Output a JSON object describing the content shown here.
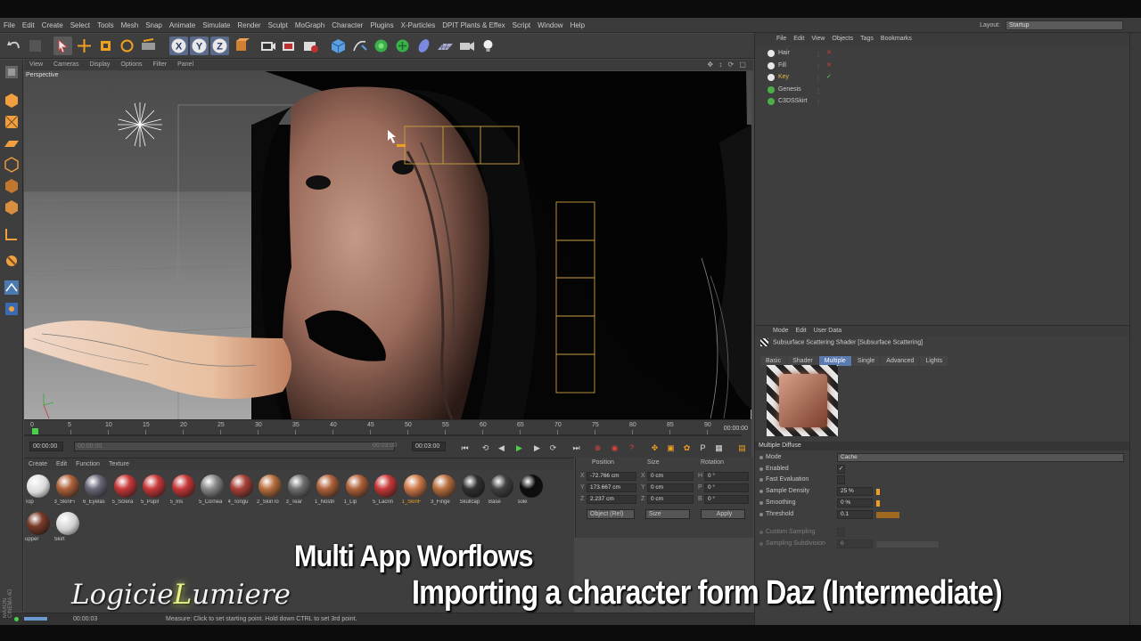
{
  "menu": [
    "File",
    "Edit",
    "Create",
    "Select",
    "Tools",
    "Mesh",
    "Snap",
    "Animate",
    "Simulate",
    "Render",
    "Sculpt",
    "MoGraph",
    "Character",
    "Plugins",
    "X-Particles",
    "DPIT Plants & Effex",
    "Script",
    "Window",
    "Help"
  ],
  "layout": {
    "label": "Layout:",
    "value": "Startup"
  },
  "viewport_menu": [
    "View",
    "Cameras",
    "Display",
    "Options",
    "Filter",
    "Panel"
  ],
  "viewport_label": "Perspective",
  "timeline": {
    "ticks": [
      "0",
      "5",
      "10",
      "15",
      "20",
      "25",
      "30",
      "35",
      "40",
      "45",
      "50",
      "55",
      "60",
      "65",
      "70",
      "75",
      "80",
      "85",
      "90"
    ],
    "end_frame": "00:00:00",
    "start_field": "00:00:00",
    "start_field2": "00:00:00",
    "end_field": "00:03:00",
    "end_field2": "00:03:00"
  },
  "material_menu": [
    "Create",
    "Edit",
    "Function",
    "Texture"
  ],
  "materials": [
    {
      "label": "Top",
      "color": "#d8d8d8"
    },
    {
      "label": "3_SkinFi",
      "color": "#b0623a"
    },
    {
      "label": "6_Eyelas",
      "color": "#6a6a7a"
    },
    {
      "label": "5_Sclera",
      "color": "#c93838"
    },
    {
      "label": "5_Pupil",
      "color": "#c93838"
    },
    {
      "label": "5_Iris",
      "color": "#c93838"
    },
    {
      "label": "5_Cornea",
      "color": "#8a8a8a"
    },
    {
      "label": "4_Tongu",
      "color": "#a84038"
    },
    {
      "label": "2_SkinTo",
      "color": "#b9703f"
    },
    {
      "label": "3_Tear",
      "color": "#707070"
    },
    {
      "label": "1_Nostri",
      "color": "#b0623a"
    },
    {
      "label": "1_Lip",
      "color": "#b0623a"
    },
    {
      "label": "5_Lacrin",
      "color": "#c93838"
    },
    {
      "label": "1_SkinF",
      "color": "#d07a4a"
    },
    {
      "label": "3_Finge",
      "color": "#b9703f"
    },
    {
      "label": "Skullcap",
      "color": "#303030"
    },
    {
      "label": "Base",
      "color": "#404040"
    },
    {
      "label": "sole",
      "color": "#0c0c0c"
    },
    {
      "label": "upper",
      "color": "#7a3a28"
    },
    {
      "label": "Skirt",
      "color": "#cfcfcf"
    }
  ],
  "coords": {
    "headers": [
      "Position",
      "Size",
      "Rotation"
    ],
    "rows": [
      {
        "a": "X",
        "p": "-72.766 cm",
        "b": "X",
        "s": "0 cm",
        "c": "H",
        "r": "0 °"
      },
      {
        "a": "Y",
        "p": "173.667 cm",
        "b": "Y",
        "s": "0 cm",
        "c": "P",
        "r": "0 °"
      },
      {
        "a": "Z",
        "p": "2.237 cm",
        "b": "Z",
        "s": "0 cm",
        "c": "B",
        "r": "0 °"
      }
    ],
    "mode": "Object (Rel)",
    "size_mode": "Size",
    "apply": "Apply"
  },
  "object_menu": [
    "File",
    "Edit",
    "View",
    "Objects",
    "Tags",
    "Bookmarks"
  ],
  "objects": [
    {
      "name": "Hair",
      "color": "#c9c9c9",
      "flag": "✕",
      "flag_color": "#d83a3a"
    },
    {
      "name": "Fill",
      "color": "#c9c9c9",
      "flag": "✕",
      "flag_color": "#d83a3a"
    },
    {
      "name": "Key",
      "color": "#e8b84a",
      "flag": "✓",
      "flag_color": "#6ad06a"
    },
    {
      "name": "Genesis",
      "color": "#c9c9c9",
      "flag": "",
      "flag_color": "#888"
    },
    {
      "name": "C3DSSkirt",
      "color": "#c9c9c9",
      "flag": "",
      "flag_color": "#888"
    }
  ],
  "attr_menu": [
    "Mode",
    "Edit",
    "User Data"
  ],
  "attr_title": "Subsurface Scattering Shader [Subsurface Scattering]",
  "attr_tabs": [
    {
      "label": "Basic",
      "on": false
    },
    {
      "label": "Shader",
      "on": false
    },
    {
      "label": "Multiple",
      "on": true
    },
    {
      "label": "Single",
      "on": false
    },
    {
      "label": "Advanced",
      "on": false
    },
    {
      "label": "Lights",
      "on": false
    }
  ],
  "section": "Multiple Diffuse",
  "params": [
    {
      "label": "Mode",
      "value": "Cache"
    },
    {
      "label": "Enabled",
      "value": "✓"
    },
    {
      "label": "Fast Evaluation",
      "value": ""
    },
    {
      "label": "Sample Density",
      "value": "25 %"
    },
    {
      "label": "Smoothing",
      "value": "0 %"
    },
    {
      "label": "Threshold",
      "value": "0.1"
    },
    {
      "label": "Custom Sampling",
      "value": ""
    },
    {
      "label": "Sampling Subdivision",
      "value": "6"
    }
  ],
  "status_time": "00:00:03",
  "status_msg": "Measure: Click to set starting point. Hold down CTRL to set 3rd point.",
  "overlay": {
    "line1": "Multi App Worflows",
    "line2": "Importing a character form Daz (Intermediate)",
    "logo_a": "Logicie",
    "logo_b": "L",
    "logo_c": "umiere"
  },
  "maxon": "MAXON CINEMA 4D",
  "colors": {
    "accent": "#5a7ab0",
    "key": "#e8b84a",
    "x_red": "#d83a3a"
  }
}
